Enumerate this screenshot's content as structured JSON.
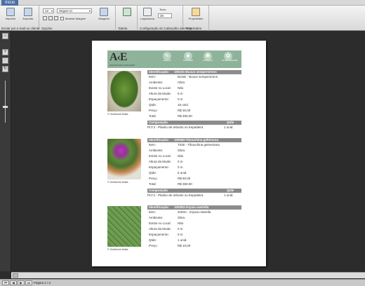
{
  "app": {
    "tab_label": "Início"
  },
  "ribbon": {
    "print_label": "Imprimir",
    "export_label": "Exportar",
    "font_size": "12",
    "font_name": "Segoe UI",
    "show_margins_label": "Mostrar Margem",
    "margins_label": "Margens",
    "table_label": "Tabela",
    "logo_label": "Logomarca",
    "text_label": "Texto",
    "text_value": "25",
    "proprietary_label": "Proprietário",
    "groups": {
      "send": "Enviar por e-mail ou cliente",
      "options": "Opções",
      "table": "Tabela",
      "header_config": "Configuração do Cabeçalho dos relat",
      "proprietary": "Proprietário"
    }
  },
  "banner": {
    "logo_text": "A‹E",
    "logo_sub": "ARQUITETURA E PAISAGISMO",
    "badges": [
      "arquitetura",
      "PAISAGISMO",
      "ILUMINAÇÃO",
      "SUSTENTABILIDADE"
    ]
  },
  "items": [
    {
      "ident_label": "Identificação:",
      "ident_value": "100101-Buxus sempervirens",
      "credit": "© Guilherme Motta",
      "fields": [
        {
          "k": "Item:",
          "v": "BUSE - Buxus sempervirens"
        },
        {
          "k": "Ambiente:",
          "v": "Obra"
        },
        {
          "k": "Existe no Local:",
          "v": "Não"
        },
        {
          "k": "Altura da Muda:",
          "v": "0 m"
        },
        {
          "k": "Espaçamento:",
          "v": "0 m"
        },
        {
          "k": "Qtde:",
          "v": "16 unid."
        },
        {
          "k": "Preço",
          "v": "R$ 30,00"
        },
        {
          "k": "Total:",
          "v": "R$ 480,00"
        }
      ],
      "comp_header": "Composição",
      "qty_header": "Qtde",
      "comp_value": "PLT.2 - Plantio de arbusto ou trepadeira",
      "comp_qty": "1 unid."
    },
    {
      "ident_label": "Identificação:",
      "ident_value": "100080-Tibouchina gelteriana",
      "credit": "© Guilherme Motta",
      "fields": [
        {
          "k": "Item:",
          "v": "TIGE - Tibouchina gelmeriana"
        },
        {
          "k": "Ambiente:",
          "v": "Obra"
        },
        {
          "k": "Existe no Local:",
          "v": "Não"
        },
        {
          "k": "Altura da Muda:",
          "v": "0 m"
        },
        {
          "k": "Espaçamento:",
          "v": "0 m"
        },
        {
          "k": "Qtde:",
          "v": "6 unid."
        },
        {
          "k": "Preço",
          "v": "R$ 60,00"
        },
        {
          "k": "Total:",
          "v": "R$ 360,00"
        }
      ],
      "comp_header": "Composição",
      "qty_header": "Qtde",
      "comp_value": "PLT.2 - Plantio de arbusto ou trepadeira",
      "comp_qty": "1 unid."
    },
    {
      "ident_label": "Identificação:",
      "ident_value": "100053-Zoysia matrella",
      "credit": "© Guilherme Motta",
      "fields": [
        {
          "k": "Item:",
          "v": "ZOMA - Zoysia matrella"
        },
        {
          "k": "Ambiente:",
          "v": "Obra"
        },
        {
          "k": "Existe no Local:",
          "v": "Não"
        },
        {
          "k": "Altura da Muda:",
          "v": "0 m"
        },
        {
          "k": "Espaçamento:",
          "v": "0 m"
        },
        {
          "k": "Qtde:",
          "v": "1 unid."
        },
        {
          "k": "Preço",
          "v": "R$ 10,00"
        }
      ]
    }
  ],
  "status": {
    "page_text": "Página 1 / 3",
    "nav": [
      "⏮",
      "◀",
      "▶",
      "⏭"
    ]
  },
  "colors": {
    "banner": "#8fb39a",
    "header_gray": "#8c8c8c",
    "tab_blue": "#4a6fa5"
  }
}
